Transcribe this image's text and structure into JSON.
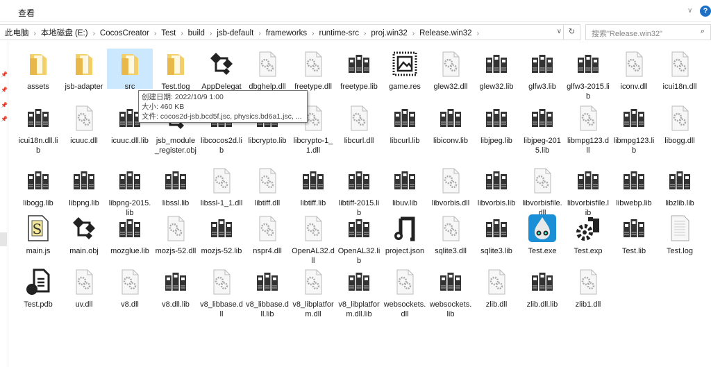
{
  "ribbon": {
    "tab_view": "查看",
    "help": "?",
    "expand": "∨"
  },
  "address": {
    "crumbs": [
      "此电脑",
      "本地磁盘 (E:)",
      "CocosCreator",
      "Test",
      "build",
      "jsb-default",
      "frameworks",
      "runtime-src",
      "proj.win32",
      "Release.win32"
    ],
    "separator": "›",
    "refresh": "↻",
    "dropdown": "∨"
  },
  "search": {
    "placeholder": "搜索\"Release.win32\"",
    "icon": "⌕"
  },
  "tooltip": {
    "created": "创建日期: 2022/10/9 1:00",
    "size": "大小: 460 KB",
    "files": "文件: cocos2d-jsb.bcd5f.jsc, physics.bd6a1.jsc, ..."
  },
  "selected_index": 2,
  "items": [
    {
      "name": "assets",
      "type": "folder"
    },
    {
      "name": "jsb-adapter",
      "type": "folder"
    },
    {
      "name": "src",
      "type": "folder"
    },
    {
      "name": "Test.tlog",
      "type": "folder"
    },
    {
      "name": "AppDelegate.obj",
      "type": "obj"
    },
    {
      "name": "dbghelp.dll",
      "type": "dll"
    },
    {
      "name": "freetype.dll",
      "type": "dll"
    },
    {
      "name": "freetype.lib",
      "type": "lib"
    },
    {
      "name": "game.res",
      "type": "res"
    },
    {
      "name": "glew32.dll",
      "type": "dll"
    },
    {
      "name": "glew32.lib",
      "type": "lib"
    },
    {
      "name": "glfw3.lib",
      "type": "lib"
    },
    {
      "name": "glfw3-2015.lib",
      "type": "lib"
    },
    {
      "name": "iconv.dll",
      "type": "dll"
    },
    {
      "name": "icui18n.dll",
      "type": "dll"
    },
    {
      "name": "icui18n.dll.lib",
      "type": "lib"
    },
    {
      "name": "icuuc.dll",
      "type": "dll"
    },
    {
      "name": "icuuc.dll.lib",
      "type": "lib"
    },
    {
      "name": "jsb_module_register.obj",
      "type": "obj"
    },
    {
      "name": "libcocos2d.lib",
      "type": "lib"
    },
    {
      "name": "libcrypto.lib",
      "type": "lib"
    },
    {
      "name": "libcrypto-1_1.dll",
      "type": "dll"
    },
    {
      "name": "libcurl.dll",
      "type": "dll"
    },
    {
      "name": "libcurl.lib",
      "type": "lib"
    },
    {
      "name": "libiconv.lib",
      "type": "lib"
    },
    {
      "name": "libjpeg.lib",
      "type": "lib"
    },
    {
      "name": "libjpeg-2015.lib",
      "type": "lib"
    },
    {
      "name": "libmpg123.dll",
      "type": "dll"
    },
    {
      "name": "libmpg123.lib",
      "type": "lib"
    },
    {
      "name": "libogg.dll",
      "type": "dll"
    },
    {
      "name": "libogg.lib",
      "type": "lib"
    },
    {
      "name": "libpng.lib",
      "type": "lib"
    },
    {
      "name": "libpng-2015.lib",
      "type": "lib"
    },
    {
      "name": "libssl.lib",
      "type": "lib"
    },
    {
      "name": "libssl-1_1.dll",
      "type": "dll"
    },
    {
      "name": "libtiff.dll",
      "type": "dll"
    },
    {
      "name": "libtiff.lib",
      "type": "lib"
    },
    {
      "name": "libtiff-2015.lib",
      "type": "lib"
    },
    {
      "name": "libuv.lib",
      "type": "lib"
    },
    {
      "name": "libvorbis.dll",
      "type": "dll"
    },
    {
      "name": "libvorbis.lib",
      "type": "lib"
    },
    {
      "name": "libvorbisfile.dll",
      "type": "dll"
    },
    {
      "name": "libvorbisfile.lib",
      "type": "lib"
    },
    {
      "name": "libwebp.lib",
      "type": "lib"
    },
    {
      "name": "libzlib.lib",
      "type": "lib"
    },
    {
      "name": "main.js",
      "type": "js"
    },
    {
      "name": "main.obj",
      "type": "obj"
    },
    {
      "name": "mozglue.lib",
      "type": "lib"
    },
    {
      "name": "mozjs-52.dll",
      "type": "dll"
    },
    {
      "name": "mozjs-52.lib",
      "type": "lib"
    },
    {
      "name": "nspr4.dll",
      "type": "dll"
    },
    {
      "name": "OpenAL32.dll",
      "type": "dll"
    },
    {
      "name": "OpenAL32.lib",
      "type": "lib"
    },
    {
      "name": "project.json",
      "type": "json"
    },
    {
      "name": "sqlite3.dll",
      "type": "dll"
    },
    {
      "name": "sqlite3.lib",
      "type": "lib"
    },
    {
      "name": "Test.exe",
      "type": "exe"
    },
    {
      "name": "Test.exp",
      "type": "exp"
    },
    {
      "name": "Test.lib",
      "type": "lib"
    },
    {
      "name": "Test.log",
      "type": "log"
    },
    {
      "name": "Test.pdb",
      "type": "pdb"
    },
    {
      "name": "uv.dll",
      "type": "dll"
    },
    {
      "name": "v8.dll",
      "type": "dll"
    },
    {
      "name": "v8.dll.lib",
      "type": "lib"
    },
    {
      "name": "v8_libbase.dll",
      "type": "dll"
    },
    {
      "name": "v8_libbase.dll.lib",
      "type": "lib"
    },
    {
      "name": "v8_libplatform.dll",
      "type": "dll"
    },
    {
      "name": "v8_libplatform.dll.lib",
      "type": "lib"
    },
    {
      "name": "websockets.dll",
      "type": "dll"
    },
    {
      "name": "websockets.lib",
      "type": "lib"
    },
    {
      "name": "zlib.dll",
      "type": "dll"
    },
    {
      "name": "zlib.dll.lib",
      "type": "lib"
    },
    {
      "name": "zlib1.dll",
      "type": "dll"
    }
  ]
}
